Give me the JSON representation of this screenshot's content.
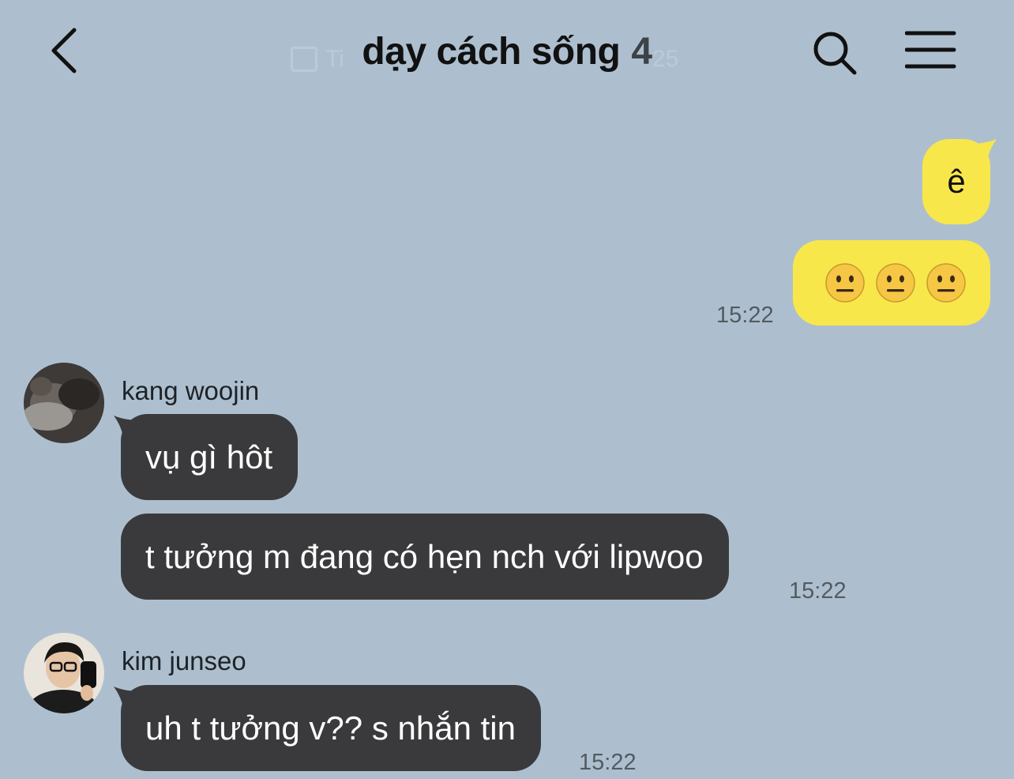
{
  "header": {
    "title": "dạy cách sống",
    "member_count": "4",
    "notice_text": "Ti",
    "notice_date": "25"
  },
  "messages": {
    "me": {
      "text1": "ê",
      "emoji": "😐😐😐",
      "time": "15:22"
    },
    "woojin": {
      "name": "kang woojin",
      "msg1": "vụ gì hôt",
      "msg2": "t tưởng m đang có hẹn nch với lipwoo",
      "time": "15:22"
    },
    "junseo": {
      "name": "kim junseo",
      "msg1": "uh t tưởng v?? s nhắn tin",
      "time": "15:22"
    }
  },
  "colors": {
    "background": "#adbfcf",
    "my_bubble": "#f8e74b",
    "other_bubble": "#3a3a3c"
  },
  "icons": {
    "back": "chevron-left-icon",
    "search": "search-icon",
    "menu": "hamburger-menu-icon"
  }
}
